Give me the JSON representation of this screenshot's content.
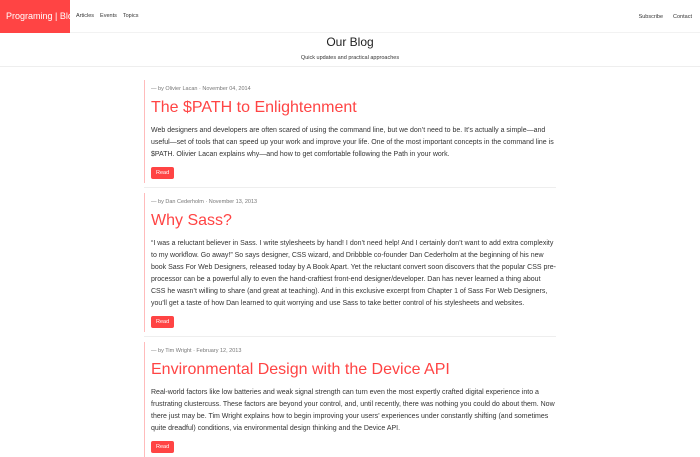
{
  "nav": {
    "brand": "Programing | Blog",
    "links": [
      "Articles",
      "Events",
      "Topics"
    ],
    "right": [
      "Subscribe",
      "Contact"
    ]
  },
  "hero": {
    "title": "Our Blog",
    "subtitle": "Quick updates and practical approaches"
  },
  "posts": [
    {
      "meta": "— by Olivier Lacan · November 04, 2014",
      "title": "The $PATH to Enlightenment",
      "body": "Web designers and developers are often scared of using the command line, but we don’t need to be. It’s actually a simple—and useful—set of tools that can speed up your work and improve your life. One of the most important concepts in the command line is $PATH. Olivier Lacan explains why—and how to get comfortable following the Path in your work.",
      "button": "Read"
    },
    {
      "meta": "— by Dan Cederholm · November 13, 2013",
      "title": "Why Sass?",
      "body": "“I was a reluctant believer in Sass. I write stylesheets by hand! I don’t need help! And I certainly don’t want to add extra complexity to my workflow. Go away!” So says designer, CSS wizard, and Dribbble co-founder Dan Cederholm at the beginning of his new book Sass For Web Designers, released today by A Book Apart. Yet the reluctant convert soon discovers that the popular CSS pre-processor can be a powerful ally to even the hand-craftiest front-end designer/developer. Dan has never learned a thing about CSS he wasn’t willing to share (and great at teaching). And in this exclusive excerpt from Chapter 1 of Sass For Web Designers, you’ll get a taste of how Dan learned to quit worrying and use Sass to take better control of his stylesheets and websites.",
      "button": "Read"
    },
    {
      "meta": "— by Tim Wright · February 12, 2013",
      "title": "Environmental Design with the Device API",
      "body": "Real-world factors like low batteries and weak signal strength can turn even the most expertly crafted digital experience into a frustrating clustercuss. These factors are beyond your control, and, until recently, there was nothing you could do about them. Now there just may be. Tim Wright explains how to begin improving your users’ experiences under constantly shifting (and sometimes quite dreadful) conditions, via environmental design thinking and the Device API.",
      "button": "Read"
    }
  ]
}
